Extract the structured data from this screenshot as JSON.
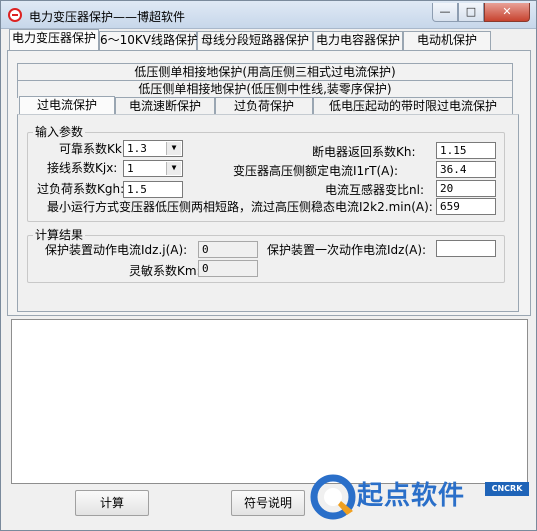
{
  "window": {
    "title": "电力变压器保护——博超软件",
    "min_glyph": "—",
    "max_glyph": "□",
    "close_glyph": "✕"
  },
  "main_tabs": [
    {
      "label": "电力变压器保护"
    },
    {
      "label": "6～10KV线路保护"
    },
    {
      "label": "母线分段短路器保护"
    },
    {
      "label": "电力电容器保护"
    },
    {
      "label": "电动机保护"
    }
  ],
  "sub_tabs_row1": "低压侧单相接地保护(用高压侧三相式过电流保护)",
  "sub_tabs_row2": "低压侧单相接地保护(低压侧中性线,装零序保护)",
  "sub_tabs_row3": [
    {
      "label": "过电流保护"
    },
    {
      "label": "电流速断保护"
    },
    {
      "label": "过负荷保护"
    },
    {
      "label": "低电压起动的带时限过电流保护"
    }
  ],
  "input_group": {
    "title": "输入参数",
    "kk_label": "可靠系数Kk:",
    "kk_value": "1.3",
    "kjx_label": "接线系数Kjx:",
    "kjx_value": "1",
    "kgh_label": "过负荷系数Kgh:",
    "kgh_value": "1.5",
    "kh_label": "断电器返回系数Kh:",
    "kh_value": "1.15",
    "i1rt_label": "变压器高压侧额定电流I1rT(A):",
    "i1rt_value": "36.4",
    "nl_label": "电流互感器变比nl:",
    "nl_value": "20",
    "i2k2_label": "最小运行方式变压器低压侧两相短路，流过高压侧稳态电流I2k2.min(A):",
    "i2k2_value": "659"
  },
  "result_group": {
    "title": "计算结果",
    "idzj_label": "保护装置动作电流Idz.j(A):",
    "idzj_value": "0",
    "idz_label": "保护装置一次动作电流Idz(A):",
    "idz_value": "",
    "km_label": "灵敏系数Km:",
    "km_value": "0"
  },
  "buttons": {
    "calc": "计算",
    "symbols": "符号说明"
  },
  "watermark": {
    "text": "起点软件",
    "tag": "CNCRK"
  }
}
